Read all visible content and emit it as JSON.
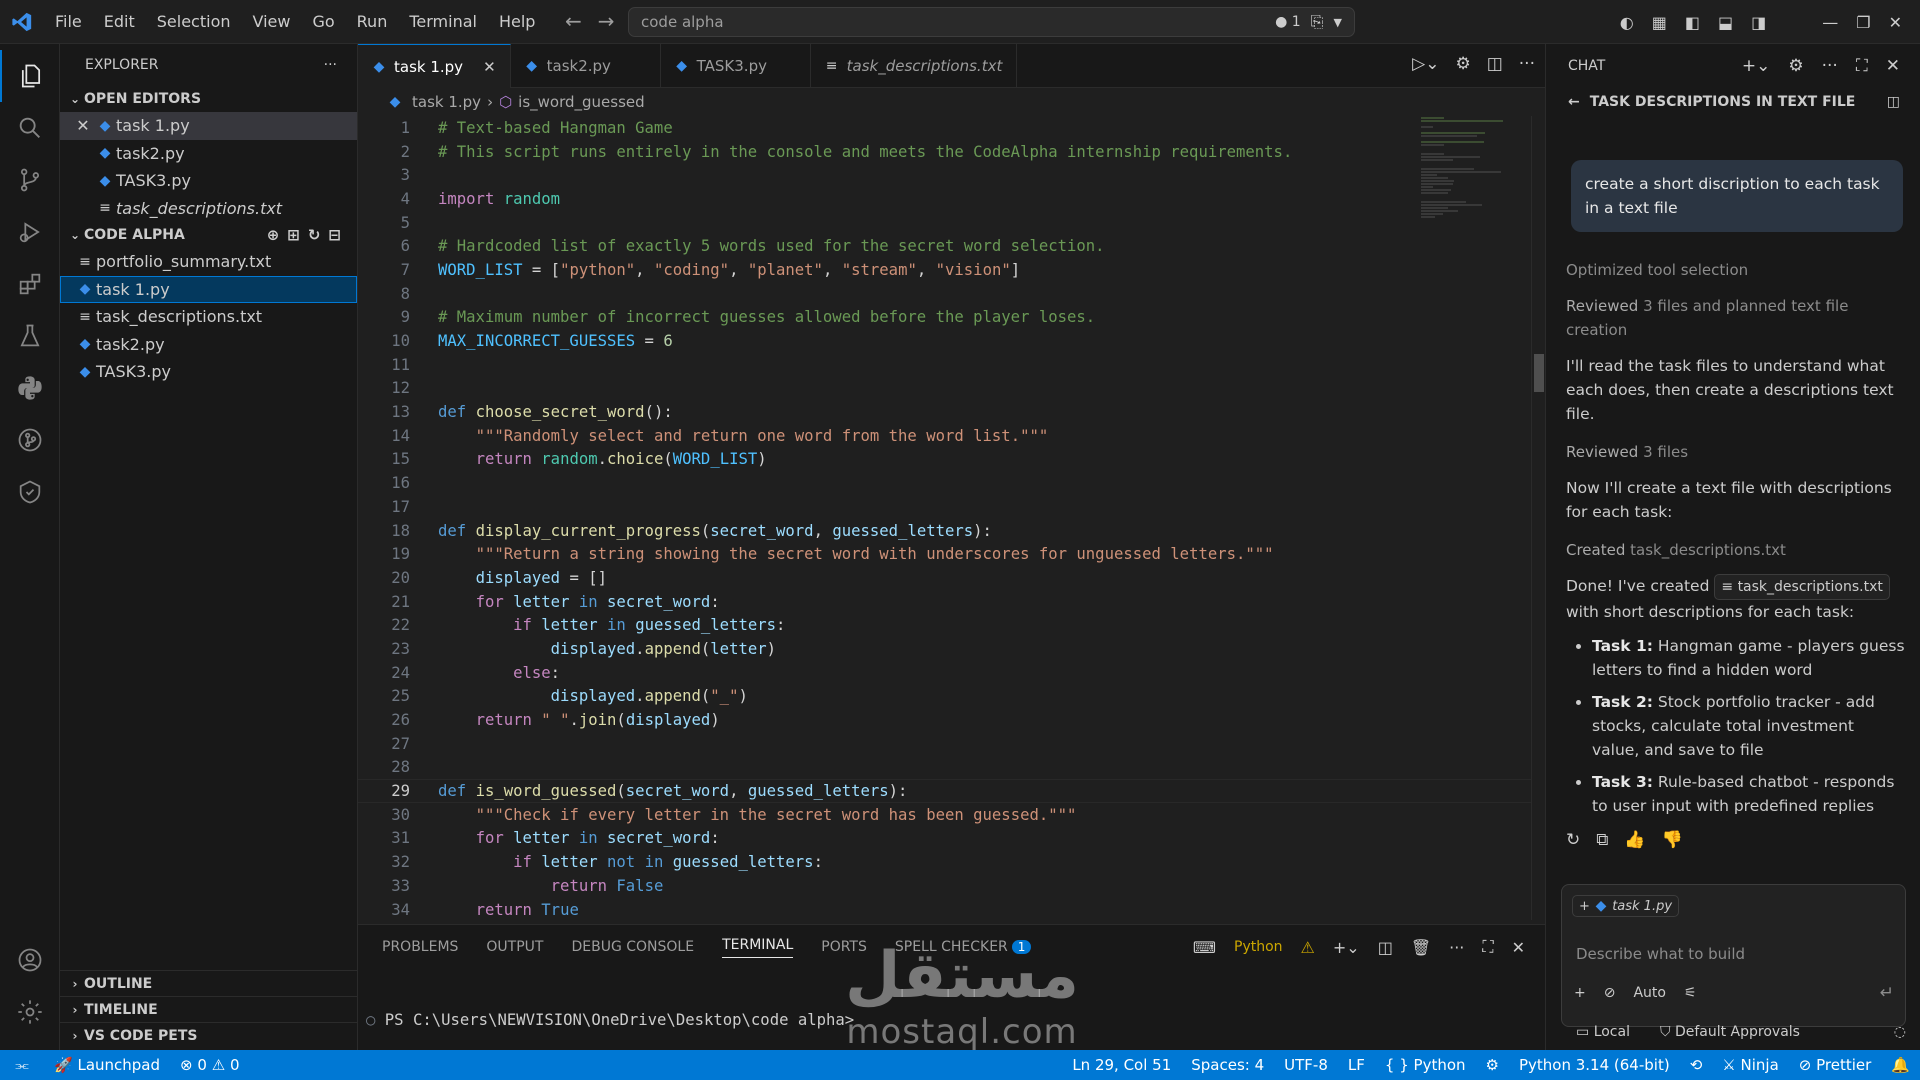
{
  "window": {
    "menus": [
      "File",
      "Edit",
      "Selection",
      "View",
      "Go",
      "Run",
      "Terminal",
      "Help"
    ],
    "search_text": "code alpha",
    "search_badge": "1"
  },
  "explorer": {
    "title": "EXPLORER",
    "open_editors_label": "OPEN EDITORS",
    "open_editors": [
      {
        "name": "task 1.py",
        "type": "py"
      },
      {
        "name": "task2.py",
        "type": "py"
      },
      {
        "name": "TASK3.py",
        "type": "py"
      },
      {
        "name": "task_descriptions.txt",
        "type": "txt"
      }
    ],
    "folder_label": "CODE ALPHA",
    "files": [
      {
        "name": "portfolio_summary.txt",
        "type": "txt"
      },
      {
        "name": "task 1.py",
        "type": "py"
      },
      {
        "name": "task_descriptions.txt",
        "type": "txt"
      },
      {
        "name": "task2.py",
        "type": "py"
      },
      {
        "name": "TASK3.py",
        "type": "py"
      }
    ],
    "outline_label": "OUTLINE",
    "timeline_label": "TIMELINE",
    "pets_label": "VS CODE PETS"
  },
  "editor": {
    "tabs": [
      {
        "name": "task 1.py",
        "type": "py"
      },
      {
        "name": "task2.py",
        "type": "py"
      },
      {
        "name": "TASK3.py",
        "type": "py"
      },
      {
        "name": "task_descriptions.txt",
        "type": "txt"
      }
    ],
    "breadcrumb_file": "task 1.py",
    "breadcrumb_symbol": "is_word_guessed",
    "current_line": 29,
    "lines": [
      [
        [
          "c-com",
          "# Text-based Hangman Game"
        ]
      ],
      [
        [
          "c-com",
          "# This script runs entirely in the console and meets the CodeAlpha internship requirements."
        ]
      ],
      [],
      [
        [
          "c-kw2",
          "import"
        ],
        [
          "c-def",
          " "
        ],
        [
          "c-mod",
          "random"
        ]
      ],
      [],
      [
        [
          "c-com",
          "# Hardcoded list of exactly 5 words used for the secret word selection."
        ]
      ],
      [
        [
          "c-const",
          "WORD_LIST"
        ],
        [
          "c-def",
          " = ["
        ],
        [
          "c-str",
          "\"python\""
        ],
        [
          "c-def",
          ", "
        ],
        [
          "c-str",
          "\"coding\""
        ],
        [
          "c-def",
          ", "
        ],
        [
          "c-str",
          "\"planet\""
        ],
        [
          "c-def",
          ", "
        ],
        [
          "c-str",
          "\"stream\""
        ],
        [
          "c-def",
          ", "
        ],
        [
          "c-str",
          "\"vision\""
        ],
        [
          "c-def",
          "]"
        ]
      ],
      [],
      [
        [
          "c-com",
          "# Maximum number of incorrect guesses allowed before the player loses."
        ]
      ],
      [
        [
          "c-const",
          "MAX_INCORRECT_GUESSES"
        ],
        [
          "c-def",
          " = "
        ],
        [
          "c-num",
          "6"
        ]
      ],
      [],
      [],
      [
        [
          "c-kw",
          "def"
        ],
        [
          "c-def",
          " "
        ],
        [
          "c-fn",
          "choose_secret_word"
        ],
        [
          "c-def",
          "():"
        ]
      ],
      [
        [
          "c-def",
          "    "
        ],
        [
          "c-str",
          "\"\"\"Randomly select and return one word from the word list.\"\"\""
        ]
      ],
      [
        [
          "c-def",
          "    "
        ],
        [
          "c-kw2",
          "return"
        ],
        [
          "c-def",
          " "
        ],
        [
          "c-mod",
          "random"
        ],
        [
          "c-def",
          "."
        ],
        [
          "c-fn",
          "choice"
        ],
        [
          "c-def",
          "("
        ],
        [
          "c-const",
          "WORD_LIST"
        ],
        [
          "c-def",
          ")"
        ]
      ],
      [],
      [],
      [
        [
          "c-kw",
          "def"
        ],
        [
          "c-def",
          " "
        ],
        [
          "c-fn",
          "display_current_progress"
        ],
        [
          "c-def",
          "("
        ],
        [
          "c-var",
          "secret_word"
        ],
        [
          "c-def",
          ", "
        ],
        [
          "c-var",
          "guessed_letters"
        ],
        [
          "c-def",
          "):"
        ]
      ],
      [
        [
          "c-def",
          "    "
        ],
        [
          "c-str",
          "\"\"\"Return a string showing the secret word with underscores for unguessed letters.\"\"\""
        ]
      ],
      [
        [
          "c-def",
          "    "
        ],
        [
          "c-var",
          "displayed"
        ],
        [
          "c-def",
          " = []"
        ]
      ],
      [
        [
          "c-def",
          "    "
        ],
        [
          "c-kw2",
          "for"
        ],
        [
          "c-def",
          " "
        ],
        [
          "c-var",
          "letter"
        ],
        [
          "c-def",
          " "
        ],
        [
          "c-kw",
          "in"
        ],
        [
          "c-def",
          " "
        ],
        [
          "c-var",
          "secret_word"
        ],
        [
          "c-def",
          ":"
        ]
      ],
      [
        [
          "c-def",
          "        "
        ],
        [
          "c-kw2",
          "if"
        ],
        [
          "c-def",
          " "
        ],
        [
          "c-var",
          "letter"
        ],
        [
          "c-def",
          " "
        ],
        [
          "c-kw",
          "in"
        ],
        [
          "c-def",
          " "
        ],
        [
          "c-var",
          "guessed_letters"
        ],
        [
          "c-def",
          ":"
        ]
      ],
      [
        [
          "c-def",
          "            "
        ],
        [
          "c-var",
          "displayed"
        ],
        [
          "c-def",
          "."
        ],
        [
          "c-fn",
          "append"
        ],
        [
          "c-def",
          "("
        ],
        [
          "c-var",
          "letter"
        ],
        [
          "c-def",
          ")"
        ]
      ],
      [
        [
          "c-def",
          "        "
        ],
        [
          "c-kw2",
          "else"
        ],
        [
          "c-def",
          ":"
        ]
      ],
      [
        [
          "c-def",
          "            "
        ],
        [
          "c-var",
          "displayed"
        ],
        [
          "c-def",
          "."
        ],
        [
          "c-fn",
          "append"
        ],
        [
          "c-def",
          "("
        ],
        [
          "c-str",
          "\"_\""
        ],
        [
          "c-def",
          ")"
        ]
      ],
      [
        [
          "c-def",
          "    "
        ],
        [
          "c-kw2",
          "return"
        ],
        [
          "c-def",
          " "
        ],
        [
          "c-str",
          "\" \""
        ],
        [
          "c-def",
          "."
        ],
        [
          "c-fn",
          "join"
        ],
        [
          "c-def",
          "("
        ],
        [
          "c-var",
          "displayed"
        ],
        [
          "c-def",
          ")"
        ]
      ],
      [],
      [],
      [
        [
          "c-kw",
          "def"
        ],
        [
          "c-def",
          " "
        ],
        [
          "c-fn",
          "is_word_guessed"
        ],
        [
          "c-def",
          "("
        ],
        [
          "c-var",
          "secret_word"
        ],
        [
          "c-def",
          ", "
        ],
        [
          "c-var",
          "guessed_letters"
        ],
        [
          "c-def",
          "):"
        ]
      ],
      [
        [
          "c-def",
          "    "
        ],
        [
          "c-str",
          "\"\"\"Check if every letter in the secret word has been guessed.\"\"\""
        ]
      ],
      [
        [
          "c-def",
          "    "
        ],
        [
          "c-kw2",
          "for"
        ],
        [
          "c-def",
          " "
        ],
        [
          "c-var",
          "letter"
        ],
        [
          "c-def",
          " "
        ],
        [
          "c-kw",
          "in"
        ],
        [
          "c-def",
          " "
        ],
        [
          "c-var",
          "secret_word"
        ],
        [
          "c-def",
          ":"
        ]
      ],
      [
        [
          "c-def",
          "        "
        ],
        [
          "c-kw2",
          "if"
        ],
        [
          "c-def",
          " "
        ],
        [
          "c-var",
          "letter"
        ],
        [
          "c-def",
          " "
        ],
        [
          "c-kw",
          "not in"
        ],
        [
          "c-def",
          " "
        ],
        [
          "c-var",
          "guessed_letters"
        ],
        [
          "c-def",
          ":"
        ]
      ],
      [
        [
          "c-def",
          "            "
        ],
        [
          "c-kw2",
          "return"
        ],
        [
          "c-def",
          " "
        ],
        [
          "c-kw",
          "False"
        ]
      ],
      [
        [
          "c-def",
          "    "
        ],
        [
          "c-kw2",
          "return"
        ],
        [
          "c-def",
          " "
        ],
        [
          "c-kw",
          "True"
        ]
      ]
    ]
  },
  "panel": {
    "tabs": [
      "PROBLEMS",
      "OUTPUT",
      "DEBUG CONSOLE",
      "TERMINAL",
      "PORTS",
      "SPELL CHECKER"
    ],
    "active_tab": "TERMINAL",
    "spell_badge": "1",
    "shell_label": "Python",
    "prompt": "PS C:\\Users\\NEWVISION\\OneDrive\\Desktop\\code alpha>"
  },
  "chat": {
    "title": "CHAT",
    "subtitle": "TASK DESCRIPTIONS IN TEXT FILE",
    "user_message": "create a short discription to each task in a text file",
    "step1": "Optimized tool selection",
    "step2_prefix": "Reviewed",
    "step2_rest": "3 files and planned text file creation",
    "para1": "I'll read the task files to understand what each does, then create a descriptions text file.",
    "step3_prefix": "Reviewed",
    "step3_rest": "3 files",
    "para2": "Now I'll create a text file with descriptions for each task:",
    "step4_prefix": "Created",
    "step4_rest": "task_descriptions.txt",
    "done_prefix": "Done! I've created",
    "done_chip": "task_descriptions.txt",
    "done_suffix": "with short descriptions for each task:",
    "bullets": [
      {
        "label": "Task 1:",
        "text": "Hangman game - players guess letters to find a hidden word"
      },
      {
        "label": "Task 2:",
        "text": "Stock portfolio tracker - add stocks, calculate total investment value, and save to file"
      },
      {
        "label": "Task 3:",
        "text": "Rule-based chatbot - responds to user input with predefined replies"
      }
    ],
    "context_file": "task 1.py",
    "input_placeholder": "Describe what to build",
    "mode": "Auto",
    "footer_local": "Local",
    "footer_approvals": "Default Approvals"
  },
  "status": {
    "launchpad": "Launchpad",
    "errors": "0",
    "warnings": "0",
    "position": "Ln 29, Col 51",
    "spaces": "Spaces: 4",
    "encoding": "UTF-8",
    "eol": "LF",
    "language": "Python",
    "interpreter": "Python 3.14 (64-bit)",
    "ninja": "Ninja",
    "prettier": "Prettier"
  },
  "watermark": {
    "arabic": "مستقل",
    "latin": "mostaql.com"
  },
  "colors": {
    "accent": "#0078d4",
    "statusbar": "#0078d4",
    "python_icon": "#3b8eea"
  }
}
